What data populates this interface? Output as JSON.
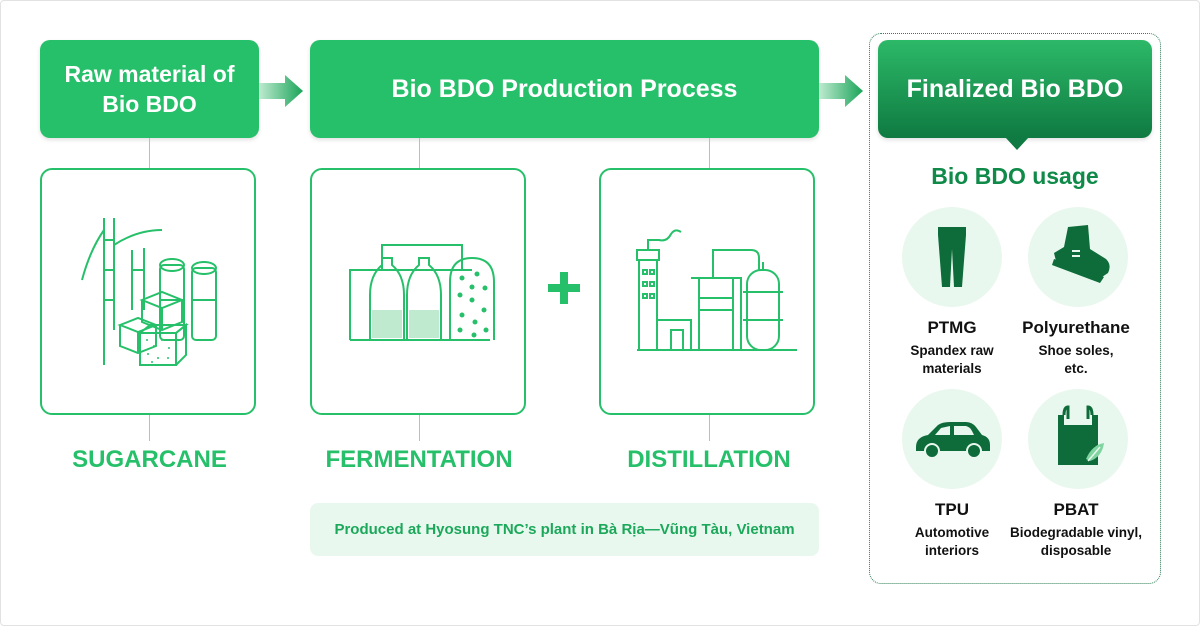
{
  "headers": {
    "raw_line1": "Raw material of",
    "raw_line2": "Bio BDO",
    "process": "Bio BDO Production Process",
    "final": "Finalized Bio BDO"
  },
  "stages": {
    "sugarcane": "SUGARCANE",
    "fermentation": "FERMENTATION",
    "distillation": "DISTILLATION"
  },
  "note": "Produced at Hyosung TNC’s plant in Bà Rịa—Vũng Tàu, Vietnam",
  "usage": {
    "title": "Bio BDO usage",
    "items": [
      {
        "name": "PTMG",
        "desc_line1": "Spandex raw",
        "desc_line2": "materials",
        "icon": "leggings-icon"
      },
      {
        "name": "Polyurethane",
        "desc_line1": "Shoe soles,",
        "desc_line2": "etc.",
        "icon": "shoe-icon"
      },
      {
        "name": "TPU",
        "desc_line1": "Automotive",
        "desc_line2": "interiors",
        "icon": "car-icon"
      },
      {
        "name": "PBAT",
        "desc_line1": "Biodegradable vinyl,",
        "desc_line2": "disposable",
        "icon": "plastic-bag-icon"
      }
    ]
  },
  "colors": {
    "accent_green": "#27c06a",
    "dark_green": "#0f7a41",
    "light_green_bg": "#e9f8ee"
  }
}
